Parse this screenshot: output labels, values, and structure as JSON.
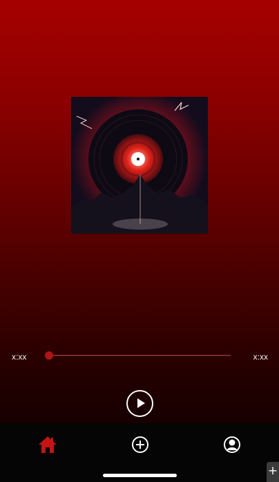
{
  "player": {
    "current_time": "x:xx",
    "total_time": "x:xx",
    "progress": 0,
    "album_art": "vinyl-record-red-storm-artwork"
  },
  "controls": {
    "play_icon": "play-icon"
  },
  "tabbar": {
    "items": [
      {
        "name": "home",
        "icon": "home-icon",
        "active": true
      },
      {
        "name": "add",
        "icon": "plus-circle-icon",
        "active": false
      },
      {
        "name": "profile",
        "icon": "user-icon",
        "active": false
      }
    ]
  },
  "corner_button": {
    "label": "+"
  },
  "colors": {
    "accent": "#c41414",
    "background_top": "#a50000",
    "background_bottom": "#0a0000",
    "tabbar": "#050505"
  }
}
